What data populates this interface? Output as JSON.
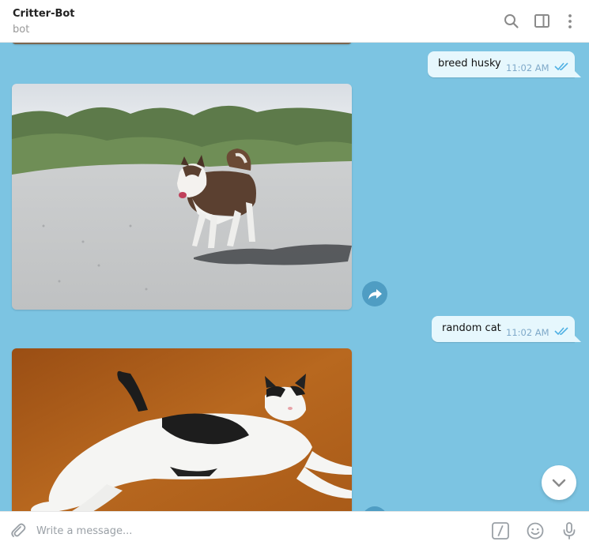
{
  "header": {
    "title": "Critter-Bot",
    "subtitle": "bot",
    "icons": [
      "search-icon",
      "sidebar-toggle-icon",
      "more-vertical-icon"
    ]
  },
  "messages": [
    {
      "type": "outgoing_text",
      "text": "breed husky",
      "time": "11:02 AM",
      "status": "read"
    },
    {
      "type": "incoming_photo",
      "subject": "husky"
    },
    {
      "type": "outgoing_text",
      "text": "random cat",
      "time": "11:02 AM",
      "status": "read"
    },
    {
      "type": "incoming_photo",
      "subject": "cat"
    }
  ],
  "composer": {
    "placeholder": "Write a message...",
    "icons": [
      "attach-icon",
      "bot-commands-icon",
      "emoji-icon",
      "microphone-icon"
    ]
  },
  "colors": {
    "chat_background": "#7cc4e2",
    "outgoing_bubble": "#e6f7fd",
    "read_ticks": "#4fb0e3",
    "forward_button": "#4f9dc3"
  }
}
